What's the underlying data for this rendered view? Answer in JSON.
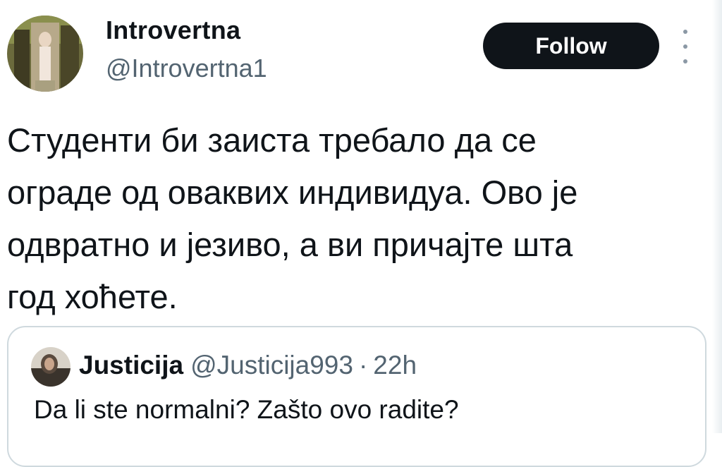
{
  "tweet": {
    "author": {
      "name": "Introvertna",
      "handle": "@Introvertna1"
    },
    "follow_label": "Follow",
    "text": "Студенти би заиста требало да се\nограде од оваквих индивидуа. Ово је\nодвратно и језиво, а ви причајте шта\nгод хоћете."
  },
  "quote": {
    "name": "Justicija",
    "handle": "@Justicija993",
    "separator": "·",
    "time": "22h",
    "text": "Da li ste normalni? Zašto ovo radite?"
  },
  "icons": {
    "more": "more-vertical-icon"
  },
  "colors": {
    "text": "#0f1419",
    "secondary": "#536471",
    "follow_bg": "#0f1419",
    "border": "#cfd9de"
  }
}
